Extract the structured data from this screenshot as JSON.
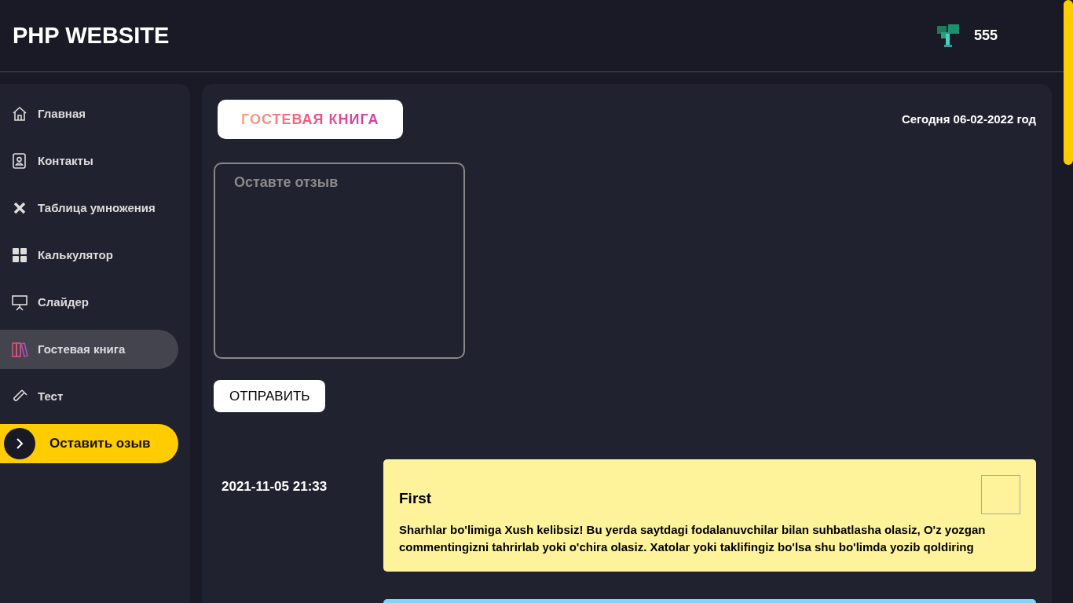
{
  "header": {
    "title": "PHP WEBSITE",
    "user_name": "555"
  },
  "sidebar": {
    "items": [
      {
        "label": "Главная",
        "selected": false
      },
      {
        "label": "Контакты",
        "selected": false
      },
      {
        "label": "Таблица умножения",
        "selected": false
      },
      {
        "label": "Калькулятор",
        "selected": false
      },
      {
        "label": "Слайдер",
        "selected": false
      },
      {
        "label": "Гостевая книга",
        "selected": true
      },
      {
        "label": "Тест",
        "selected": false
      }
    ],
    "action_button": {
      "label": "Оставить озыв"
    }
  },
  "main": {
    "heading": "ГОСТЕВАЯ КНИГА",
    "date": "Сегодня 06-02-2022 год",
    "review_field": {
      "placeholder": "Оставте отзыв"
    },
    "submit_button": "ОТПРАВИТЬ",
    "comments": [
      {
        "time": "2021-11-05 21:33",
        "title": "First",
        "text": "Sharhlar bo'limiga Xush kelibsiz! Bu yerda saytdagi fodalanuvchilar bilan suhbatlasha olasiz, O'z yozgan commentingizni tahrirlab yoki o'chira olasiz. Xatolar yoki taklifingiz bo'lsa shu bo'limda yozib qoldiring",
        "color": "#fef39a"
      },
      {
        "color": "#81d4fa"
      }
    ]
  }
}
